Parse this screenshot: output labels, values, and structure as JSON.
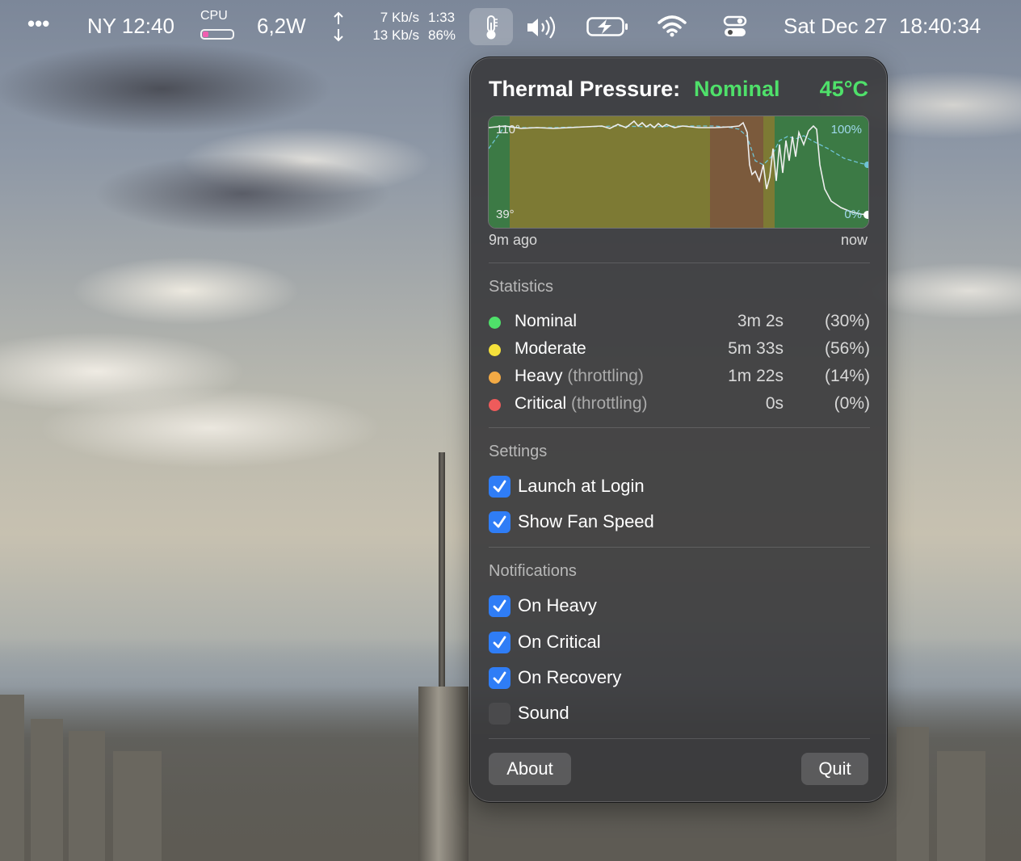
{
  "menubar": {
    "more": "•••",
    "clock_ny": "NY 12:40",
    "cpu_label": "CPU",
    "cpu_load": 0.2,
    "power": "6,2W",
    "net_up": "7 Kb/s",
    "net_down": "13 Kb/s",
    "battery_time": "1:33",
    "battery_pct": "86%",
    "datetime": "Sat Dec 27  18:40:34",
    "icons": [
      "more-icon",
      "cpu-icon",
      "updown-arrows-icon",
      "thermometer-icon",
      "speaker-icon",
      "battery-charging-icon",
      "wifi-icon",
      "control-center-icon"
    ]
  },
  "popup": {
    "title": "Thermal Pressure:",
    "status": "Nominal",
    "temperature": "45°C",
    "colors": {
      "nominal": "#4fe06a",
      "moderate": "#f5e13b",
      "heavy": "#f3aa45",
      "critical": "#ee5b5b",
      "accent": "#2f7df6"
    },
    "chart": {
      "top_left_label": "110°",
      "bottom_left_label": "39°",
      "top_right_label": "100%",
      "bottom_right_label": "0%",
      "x_start_label": "9m ago",
      "x_end_label": "now"
    },
    "statistics": {
      "heading": "Statistics",
      "rows": [
        {
          "name": "Nominal",
          "qualifier": "",
          "duration": "3m 2s",
          "percent": "(30%)",
          "color": "#4fe06a"
        },
        {
          "name": "Moderate",
          "qualifier": "",
          "duration": "5m 33s",
          "percent": "(56%)",
          "color": "#f5e13b"
        },
        {
          "name": "Heavy",
          "qualifier": " (throttling)",
          "duration": "1m 22s",
          "percent": "(14%)",
          "color": "#f3aa45"
        },
        {
          "name": "Critical",
          "qualifier": " (throttling)",
          "duration": "0s",
          "percent": "(0%)",
          "color": "#ee5b5b"
        }
      ]
    },
    "settings": {
      "heading": "Settings",
      "items": [
        {
          "label": "Launch at Login",
          "checked": true
        },
        {
          "label": "Show Fan Speed",
          "checked": true
        }
      ]
    },
    "notifications": {
      "heading": "Notifications",
      "items": [
        {
          "label": "On Heavy",
          "checked": true
        },
        {
          "label": "On Critical",
          "checked": true
        },
        {
          "label": "On Recovery",
          "checked": true
        },
        {
          "label": "Sound",
          "checked": false
        }
      ]
    },
    "about_label": "About",
    "quit_label": "Quit"
  }
}
